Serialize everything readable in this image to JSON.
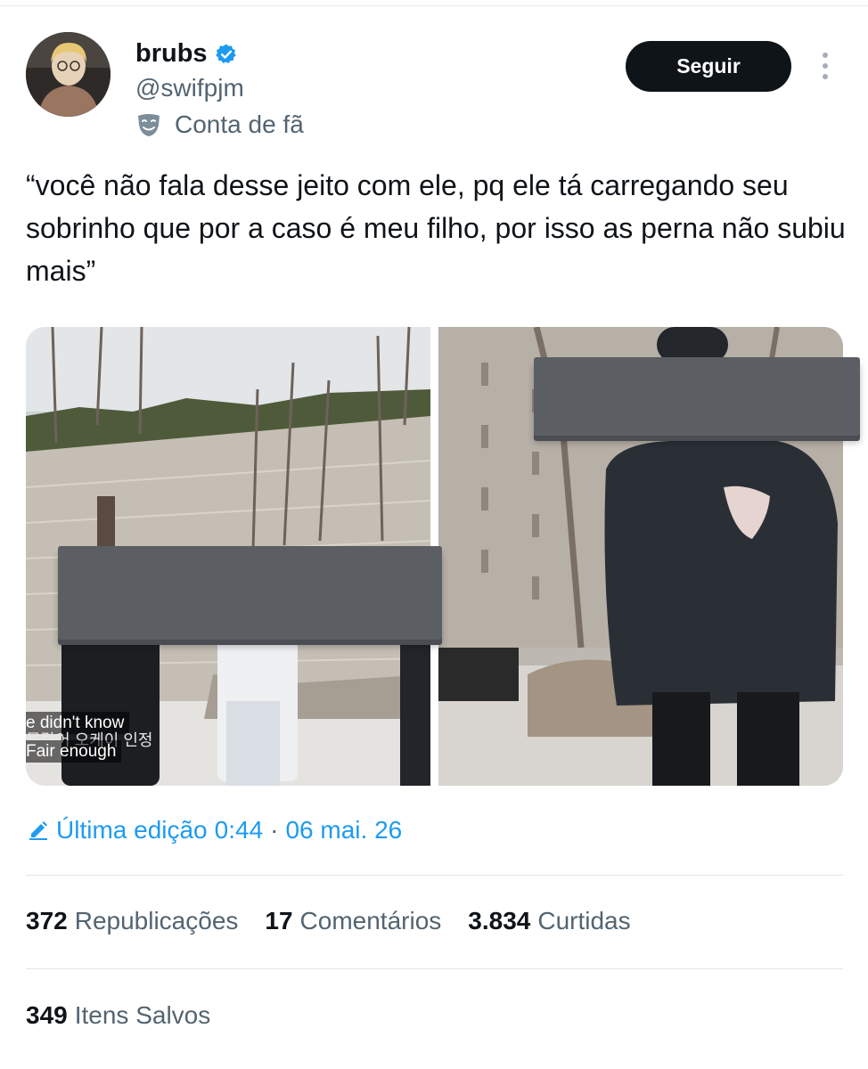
{
  "author": {
    "display_name": "brubs",
    "handle": "@swifpjm",
    "label": "Conta de fã",
    "verified_color": "#1d9bf0"
  },
  "header": {
    "follow_label": "Seguir"
  },
  "tweet": {
    "text": "“você não fala desse jeito com ele, pq ele tá carregando seu sobrinho que por a caso é meu filho, por isso as perna não subiu mais”"
  },
  "media": {
    "subtitle_line_1": "e didn't know",
    "subtitle_korean": "몰랐어 오케이 인정",
    "subtitle_line_2": "Fair enough"
  },
  "edit": {
    "label": "Última edição",
    "time": "0:44",
    "separator": "·",
    "date": "06 mai. 26"
  },
  "stats": {
    "reposts_count": "372",
    "reposts_label": "Republicações",
    "comments_count": "17",
    "comments_label": "Comentários",
    "likes_count": "3.834",
    "likes_label": "Curtidas",
    "saved_count": "349",
    "saved_label": "Itens Salvos"
  },
  "colors": {
    "accent": "#1d9bf0",
    "text": "#0f1419",
    "muted": "#536471",
    "button_bg": "#0f1419"
  },
  "icons": [
    "verified-badge-icon",
    "mask-icon",
    "more-options-icon",
    "edit-pencil-icon"
  ]
}
